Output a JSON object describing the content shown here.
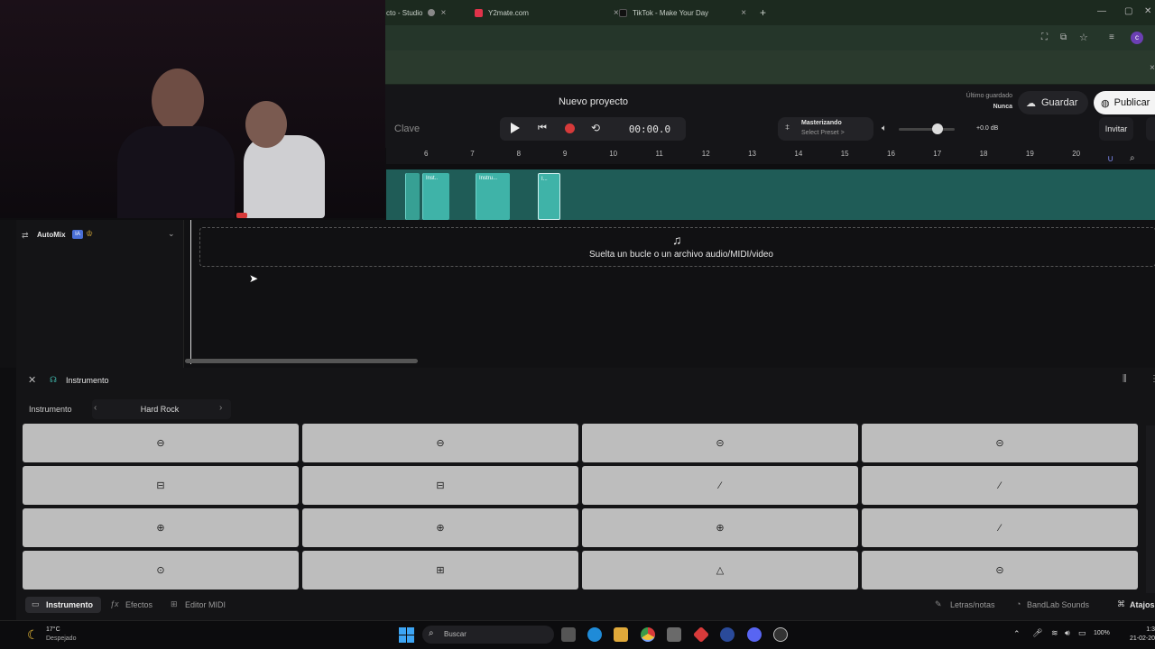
{
  "browser": {
    "tabs": [
      {
        "label": "cto - Studio"
      },
      {
        "label": "Y2mate.com"
      },
      {
        "label": "TikTok - Make Your Day"
      }
    ],
    "new_tab": "+"
  },
  "app": {
    "project_title": "Nuevo proyecto",
    "last_saved_label": "Último guardado",
    "last_saved_value": "Nunca",
    "save_button": "Guardar",
    "publish_button": "Publicar",
    "key_label": "Clave",
    "time": "00:00.0",
    "mastering_title": "Masterizando",
    "mastering_preset": "Select Preset >",
    "volume_db": "+0.0 dB",
    "invite_button": "Invitar"
  },
  "ruler": {
    "ticks": [
      "6",
      "7",
      "8",
      "9",
      "10",
      "11",
      "12",
      "13",
      "14",
      "15",
      "16",
      "17",
      "18",
      "19",
      "20"
    ]
  },
  "clips": [
    {
      "name": "Inst.."
    },
    {
      "name": "Instru..."
    },
    {
      "name": "I..."
    }
  ],
  "track": {
    "automix_label": "AutoMix",
    "automix_badge": "IA"
  },
  "dropzone": {
    "text": "Suelta un bucle o un archivo audio/MIDI/video"
  },
  "instrument_panel": {
    "header": "Instrumento",
    "selector_label": "Instrumento",
    "selected_kit": "Hard Rock",
    "pads": [
      {
        "icon": "snare-icon",
        "glyph": "⊖"
      },
      {
        "icon": "snare-icon",
        "glyph": "⊖"
      },
      {
        "icon": "drum-icon",
        "glyph": "⊝"
      },
      {
        "icon": "drum-icon",
        "glyph": "⊝"
      },
      {
        "icon": "tom-icon",
        "glyph": "⊟"
      },
      {
        "icon": "tom-icon",
        "glyph": "⊟"
      },
      {
        "icon": "stick-icon",
        "glyph": "⁄"
      },
      {
        "icon": "stick-icon",
        "glyph": "⁄"
      },
      {
        "icon": "hihat-icon",
        "glyph": "⊕"
      },
      {
        "icon": "hihat-icon",
        "glyph": "⊕"
      },
      {
        "icon": "cymbal-icon",
        "glyph": "⊕"
      },
      {
        "icon": "stick-icon",
        "glyph": "⁄"
      },
      {
        "icon": "kick-icon",
        "glyph": "⊙"
      },
      {
        "icon": "floor-tom-icon",
        "glyph": "⊞"
      },
      {
        "icon": "bell-icon",
        "glyph": "△"
      },
      {
        "icon": "drum-icon",
        "glyph": "⊝"
      }
    ]
  },
  "bottom_tabs": {
    "instrumento": "Instrumento",
    "efectos": "Efectos",
    "editor_midi": "Editor MIDI",
    "letras": "Letras/notas",
    "bandlab_sounds": "BandLab Sounds",
    "atajos": "Atajos"
  },
  "taskbar": {
    "weather_temp": "17°C",
    "weather_desc": "Despejado",
    "search_label": "Buscar",
    "battery": "100%",
    "date": "21-02-20",
    "time": "1:3"
  },
  "colors": {
    "accent_teal": "#3fb3a8",
    "track_bg": "#1f5c57",
    "record_red": "#d63a3a",
    "pad_gray": "#bdbdbd"
  }
}
